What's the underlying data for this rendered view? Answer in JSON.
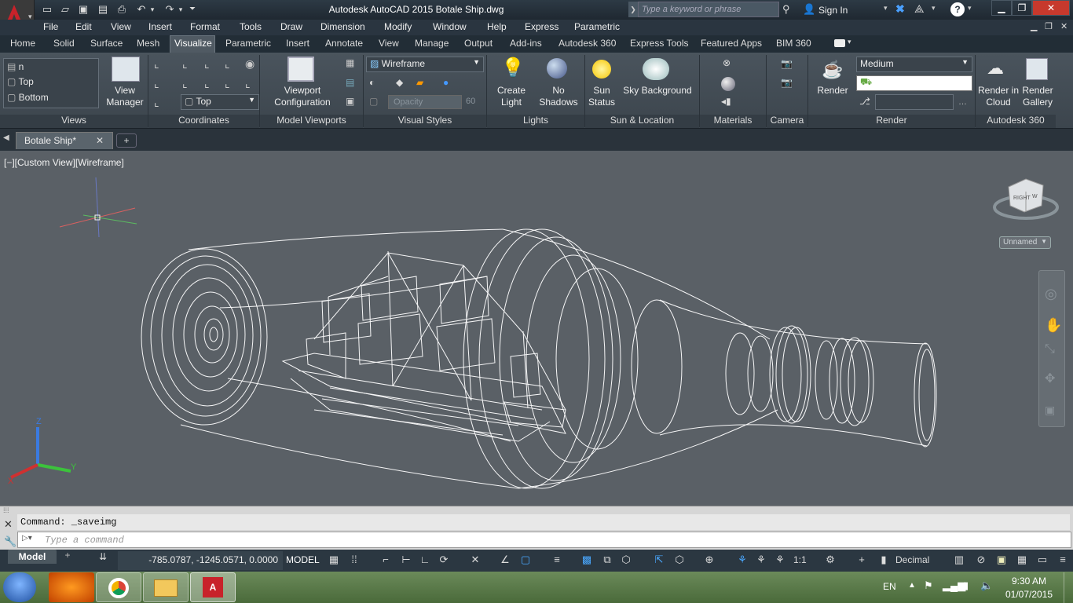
{
  "app": {
    "title": "Autodesk AutoCAD 2015    Botale Ship.dwg",
    "search_placeholder": "Type a keyword or phrase",
    "sign_in": "Sign In"
  },
  "menubar": [
    "File",
    "Edit",
    "View",
    "Insert",
    "Format",
    "Tools",
    "Draw",
    "Dimension",
    "Modify",
    "Window",
    "Help",
    "Express",
    "Parametric"
  ],
  "ribbon_tabs": [
    "Home",
    "Solid",
    "Surface",
    "Mesh",
    "Visualize",
    "Parametric",
    "Insert",
    "Annotate",
    "View",
    "Manage",
    "Output",
    "Add-ins",
    "Autodesk 360",
    "Express Tools",
    "Featured Apps",
    "BIM 360"
  ],
  "active_tab": "Visualize",
  "ribbon": {
    "views": {
      "items": [
        "n",
        "Top",
        "Bottom"
      ],
      "view_manager": "View\nManager",
      "label": "Views"
    },
    "coordinates": {
      "ucs_value": "Top",
      "label": "Coordinates"
    },
    "viewports": {
      "config": "Viewport\nConfiguration",
      "label": "Model Viewports"
    },
    "visual_styles": {
      "style": "Wireframe",
      "opacity_label": "Opacity",
      "opacity_value": "60",
      "label": "Visual Styles"
    },
    "lights": {
      "create": "Create\nLight",
      "shadows": "No\nShadows",
      "label": "Lights"
    },
    "sun": {
      "status": "Sun\nStatus",
      "sky": "Sky Background",
      "label": "Sun & Location"
    },
    "materials": {
      "label": "Materials"
    },
    "camera": {
      "label": "Camera"
    },
    "render": {
      "quality": "Medium",
      "render": "Render",
      "label": "Render"
    },
    "a360": {
      "cloud": "Render in\nCloud",
      "gallery": "Render\nGallery",
      "label": "Autodesk 360"
    }
  },
  "document": {
    "tab": "Botale Ship*"
  },
  "viewport": {
    "label": "[−][Custom View][Wireframe]",
    "viewcube_face_right": "RIGHT",
    "viewcube_face_front": "W",
    "unnamed": "Unnamed",
    "axis_z": "Z",
    "axis_y": "Y",
    "axis_x": "X"
  },
  "command": {
    "history": "Command: _saveimg",
    "placeholder": "Type a command"
  },
  "status": {
    "model_tab": "Model",
    "coordinates": "-785.0787, -1245.0571, 0.0000",
    "space": "MODEL",
    "scale": "1:1",
    "units": "Decimal"
  },
  "taskbar": {
    "lang": "EN",
    "time": "9:30 AM",
    "date": "01/07/2015"
  },
  "colors": {
    "accent": "#c8222a",
    "viewport_bg": "#5a6066",
    "wire": "#ffffff"
  }
}
